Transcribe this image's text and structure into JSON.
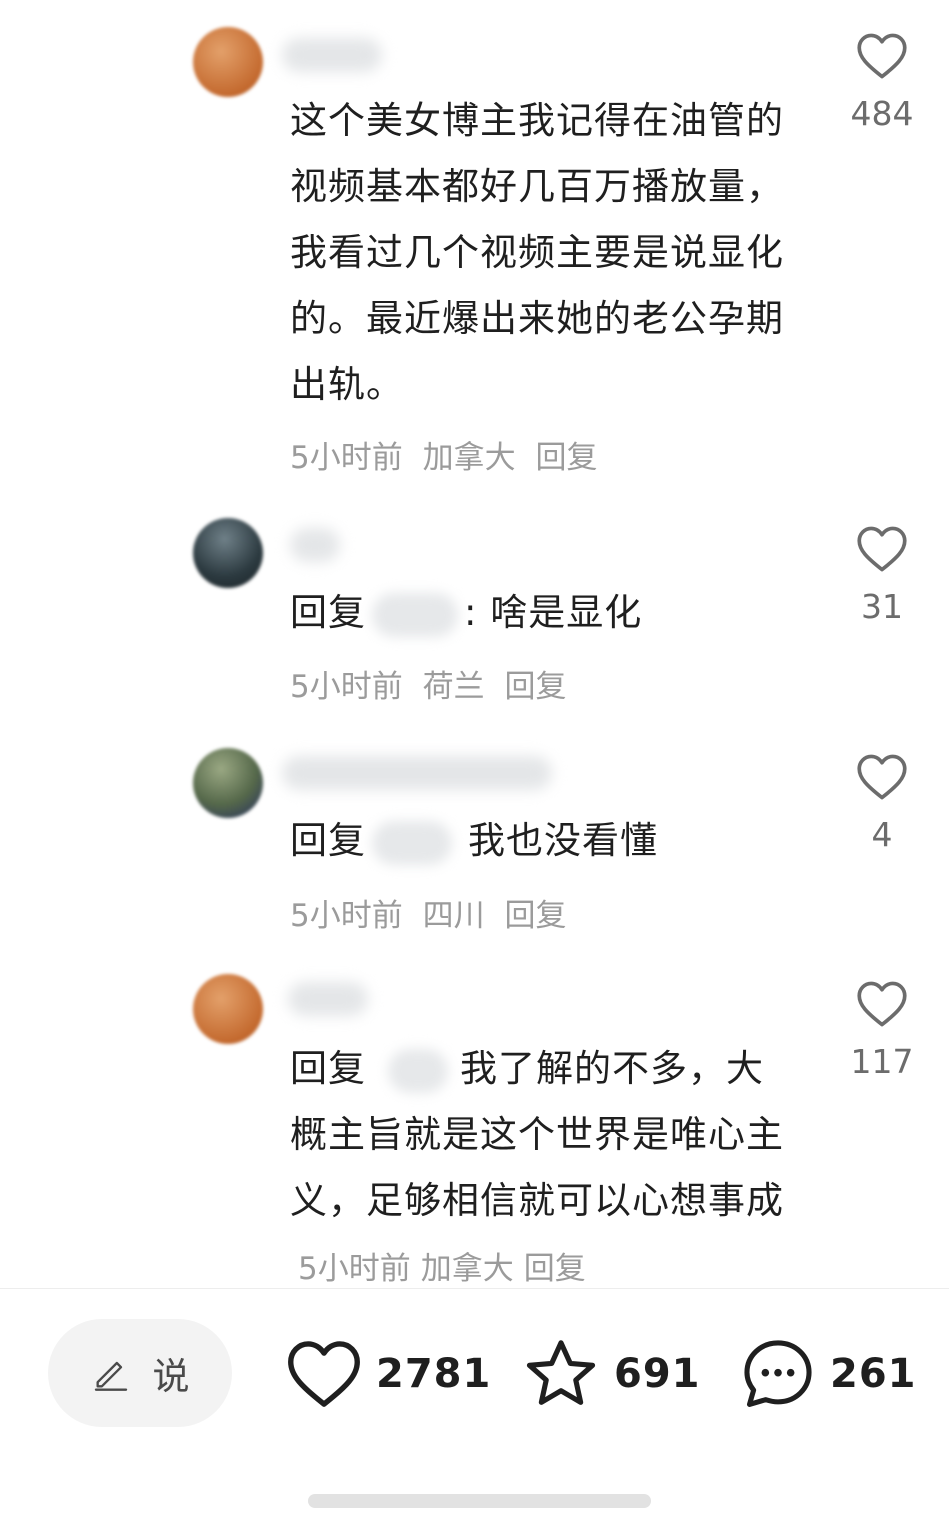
{
  "comments": [
    {
      "text": "这个美女博主我记得在油管的视频基本都好几百万播放量，我看过几个视频主要是说显化的。最近爆出来她的老公孕期出轨。",
      "time": "5小时前",
      "location": "加拿大",
      "reply_label": "回复",
      "likes": "484"
    },
    {
      "reply_prefix": "回复",
      "text": ": 啥是显化",
      "time": "5小时前",
      "location": "荷兰",
      "reply_label": "回复",
      "likes": "31"
    },
    {
      "reply_prefix": "回复",
      "text": "我也没看懂",
      "time": "5小时前",
      "location": "四川",
      "reply_label": "回复",
      "likes": "4"
    },
    {
      "reply_prefix": "回复",
      "text": "我了解的不多，大概主旨就是这个世界是唯心主义，足够相信就可以心想事成",
      "time": "5小时前",
      "location": "加拿大",
      "reply_label": "回复",
      "likes": "117"
    }
  ],
  "bottom_bar": {
    "say_label": "说",
    "likes": "2781",
    "favorites": "691",
    "comments": "261"
  },
  "icons": {
    "like": "heart-outline-icon",
    "favorite": "star-outline-icon",
    "comment": "speech-bubble-icon",
    "compose": "pencil-icon"
  },
  "colors": {
    "text": "#1f1f1f",
    "meta": "#9b9b9b",
    "icon": "#6c6c6c"
  }
}
